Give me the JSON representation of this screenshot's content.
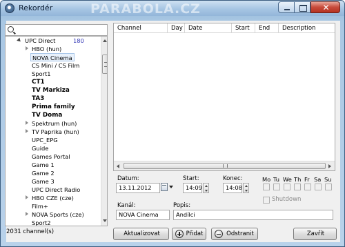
{
  "window": {
    "title": "Rekordér",
    "watermark": "PARABOLA.CZ"
  },
  "search": {
    "placeholder": ""
  },
  "tree": {
    "root": {
      "label": "UPC Direct",
      "count": "180"
    },
    "items": [
      {
        "label": "HBO (hun)",
        "expandable": true,
        "bold": false
      },
      {
        "label": "NOVA Cinema",
        "expandable": false,
        "bold": false,
        "selected": true
      },
      {
        "label": "CS Mini / CS Film",
        "expandable": false,
        "bold": false
      },
      {
        "label": "Sport1",
        "expandable": false,
        "bold": false
      },
      {
        "label": "CT1",
        "expandable": false,
        "bold": true
      },
      {
        "label": "TV Markiza",
        "expandable": false,
        "bold": true
      },
      {
        "label": "TA3",
        "expandable": false,
        "bold": true
      },
      {
        "label": "Prima family",
        "expandable": false,
        "bold": true
      },
      {
        "label": "TV Doma",
        "expandable": false,
        "bold": true
      },
      {
        "label": "Spektrum (hun)",
        "expandable": true,
        "bold": false
      },
      {
        "label": "TV Paprika (hun)",
        "expandable": true,
        "bold": false
      },
      {
        "label": "UPC_EPG",
        "expandable": false,
        "bold": false
      },
      {
        "label": "Guide",
        "expandable": false,
        "bold": false
      },
      {
        "label": "Games Portal",
        "expandable": false,
        "bold": false
      },
      {
        "label": "Game 1",
        "expandable": false,
        "bold": false
      },
      {
        "label": "Game 2",
        "expandable": false,
        "bold": false
      },
      {
        "label": "Game 3",
        "expandable": false,
        "bold": false
      },
      {
        "label": "UPC Direct Radio",
        "expandable": false,
        "bold": false
      },
      {
        "label": "HBO CZE (cze)",
        "expandable": true,
        "bold": false
      },
      {
        "label": "Film+",
        "expandable": false,
        "bold": false
      },
      {
        "label": "NOVA Sports (cze)",
        "expandable": true,
        "bold": false
      },
      {
        "label": "Sport2",
        "expandable": false,
        "bold": false
      }
    ]
  },
  "status": {
    "channels": "2031 channel(s)"
  },
  "table": {
    "columns": [
      "Channel",
      "Day",
      "Date",
      "Start",
      "End",
      "Description"
    ]
  },
  "form": {
    "date_label": "Datum:",
    "date_value": "13.11.2012",
    "start_label": "Start:",
    "start_value": "14:09",
    "end_label": "Konec:",
    "end_value": "14:08",
    "days": [
      "Mo",
      "Tu",
      "We",
      "Th",
      "Fr",
      "Sa",
      "Su"
    ],
    "shutdown_label": "Shutdown",
    "channel_label": "Kanál:",
    "channel_value": "NOVA Cinema",
    "desc_label": "Popis:",
    "desc_value": "Andílci"
  },
  "buttons": {
    "refresh": "Aktualizovat",
    "add": "Přidat",
    "remove": "Odstranit",
    "close": "Zavřít"
  }
}
